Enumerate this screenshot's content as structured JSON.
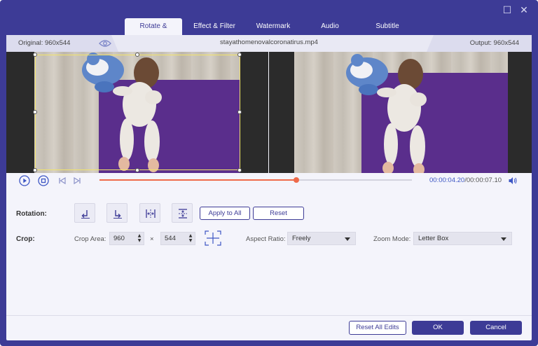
{
  "window": {
    "maximize_icon": "maximize-icon",
    "close_icon": "close-icon"
  },
  "tabs": [
    {
      "label": "Rotate & Crop",
      "active": true
    },
    {
      "label": "Effect & Filter",
      "active": false
    },
    {
      "label": "Watermark",
      "active": false
    },
    {
      "label": "Audio",
      "active": false
    },
    {
      "label": "Subtitle",
      "active": false
    }
  ],
  "info": {
    "original": "Original: 960x544",
    "filename": "stayathomenovalcoronatirus.mp4",
    "output": "Output: 960x544"
  },
  "player": {
    "current_time": "00:00:04.20",
    "total_time": "/00:00:07.10",
    "progress": 0.63
  },
  "rotation": {
    "label": "Rotation:",
    "apply_all_label": "Apply to All",
    "reset_label": "Reset"
  },
  "crop": {
    "label": "Crop:",
    "area_label": "Crop Area:",
    "width": "960",
    "times": "×",
    "height": "544",
    "aspect_label": "Aspect Ratio:",
    "aspect_value": "Freely",
    "zoom_label": "Zoom Mode:",
    "zoom_value": "Letter Box"
  },
  "footer": {
    "reset_all_label": "Reset All Edits",
    "ok_label": "OK",
    "cancel_label": "Cancel"
  },
  "colors": {
    "accent": "#3d3b96",
    "progress": "#ee6a4a",
    "time": "#3d56c4"
  }
}
